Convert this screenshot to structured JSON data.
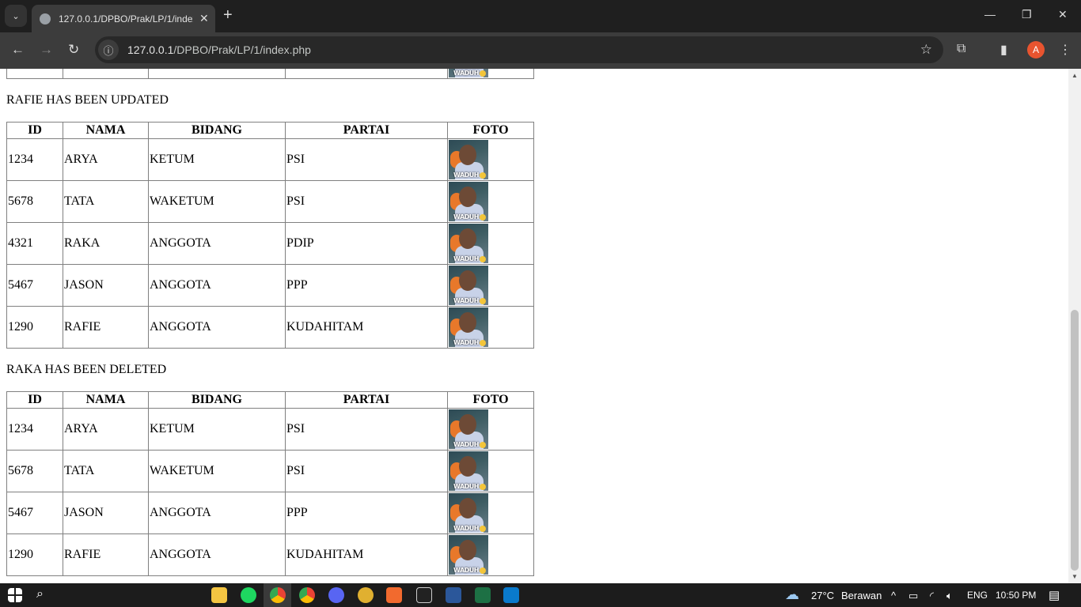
{
  "browser": {
    "tab_title": "127.0.0.1/DPBO/Prak/LP/1/index.php",
    "url_host": "127.0.0.1",
    "url_path": "/DPBO/Prak/LP/1/index.php",
    "avatar_letter": "A"
  },
  "columns": [
    "ID",
    "NAMA",
    "BIDANG",
    "PARTAI",
    "FOTO"
  ],
  "photo_caption": "WADUH",
  "messages": {
    "updated": "RAFIE HAS BEEN UPDATED",
    "deleted": "RAKA HAS BEEN DELETED"
  },
  "table_updated": [
    {
      "id": "1234",
      "nama": "ARYA",
      "bidang": "KETUM",
      "partai": "PSI"
    },
    {
      "id": "5678",
      "nama": "TATA",
      "bidang": "WAKETUM",
      "partai": "PSI"
    },
    {
      "id": "4321",
      "nama": "RAKA",
      "bidang": "ANGGOTA",
      "partai": "PDIP"
    },
    {
      "id": "5467",
      "nama": "JASON",
      "bidang": "ANGGOTA",
      "partai": "PPP"
    },
    {
      "id": "1290",
      "nama": "RAFIE",
      "bidang": "ANGGOTA",
      "partai": "KUDAHITAM"
    }
  ],
  "table_deleted": [
    {
      "id": "1234",
      "nama": "ARYA",
      "bidang": "KETUM",
      "partai": "PSI"
    },
    {
      "id": "5678",
      "nama": "TATA",
      "bidang": "WAKETUM",
      "partai": "PSI"
    },
    {
      "id": "5467",
      "nama": "JASON",
      "bidang": "ANGGOTA",
      "partai": "PPP"
    },
    {
      "id": "1290",
      "nama": "RAFIE",
      "bidang": "ANGGOTA",
      "partai": "KUDAHITAM"
    }
  ],
  "taskbar": {
    "temperature": "27°C",
    "weather": "Berawan",
    "language": "ENG",
    "time": "10:50 PM"
  }
}
